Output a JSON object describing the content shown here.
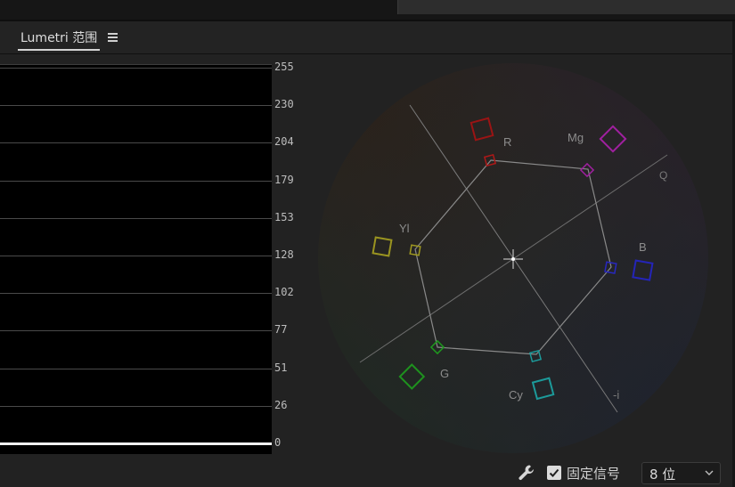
{
  "panel": {
    "tab_title": "Lumetri 范围",
    "menu_icon": "hamburger-menu-icon"
  },
  "waveform": {
    "scale_labels": [
      "255",
      "230",
      "204",
      "179",
      "153",
      "128",
      "102",
      "77",
      "51",
      "26",
      "0"
    ]
  },
  "vectorscope": {
    "targets": [
      {
        "key": "R",
        "label": "R",
        "color": "#c01818"
      },
      {
        "key": "Mg",
        "label": "Mg",
        "color": "#b020b0"
      },
      {
        "key": "B",
        "label": "B",
        "color": "#2828c8"
      },
      {
        "key": "Cy",
        "label": "Cy",
        "color": "#20a0a0"
      },
      {
        "key": "G",
        "label": "G",
        "color": "#20a020"
      },
      {
        "key": "Yl",
        "label": "Yl",
        "color": "#a8a020"
      }
    ],
    "axis_labels": {
      "q": "Q",
      "neg_i": "-i"
    }
  },
  "controls": {
    "settings_icon": "wrench-icon",
    "pin_signal_checked": true,
    "pin_signal_label": "固定信号",
    "bit_depth_value": "8 位"
  }
}
